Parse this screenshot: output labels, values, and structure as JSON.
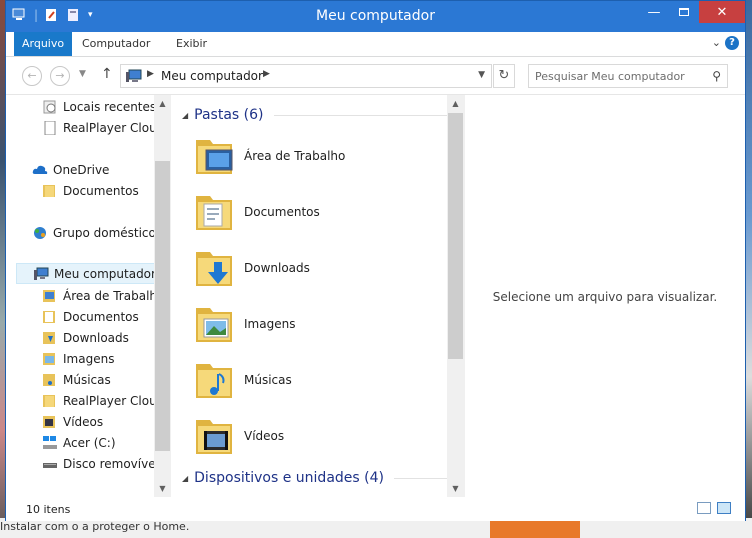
{
  "window": {
    "title": "Meu computador"
  },
  "ribbon": {
    "tabs": [
      "Arquivo",
      "Computador",
      "Exibir"
    ]
  },
  "address": {
    "crumb": "Meu computador"
  },
  "search": {
    "placeholder": "Pesquisar Meu computador"
  },
  "nav": {
    "items": [
      {
        "label": "Locais recentes",
        "icon": "recent-places-icon"
      },
      {
        "label": "RealPlayer Cloud",
        "icon": "document-icon"
      },
      {
        "label": "OneDrive",
        "icon": "cloud-icon"
      },
      {
        "label": "Documentos",
        "icon": "folder-icon"
      },
      {
        "label": "Grupo doméstico",
        "icon": "homegroup-icon"
      },
      {
        "label": "Meu computador",
        "icon": "computer-icon",
        "selected": true
      },
      {
        "label": "Área de Trabalho",
        "icon": "folder-icon"
      },
      {
        "label": "Documentos",
        "icon": "folder-icon"
      },
      {
        "label": "Downloads",
        "icon": "folder-icon"
      },
      {
        "label": "Imagens",
        "icon": "folder-icon"
      },
      {
        "label": "Músicas",
        "icon": "folder-icon"
      },
      {
        "label": "RealPlayer Cloud",
        "icon": "folder-icon"
      },
      {
        "label": "Vídeos",
        "icon": "folder-icon"
      },
      {
        "label": "Acer (C:)",
        "icon": "drive-icon"
      },
      {
        "label": "Disco removível (",
        "icon": "removable-drive-icon"
      }
    ]
  },
  "groups": {
    "folders_title": "Pastas (6)",
    "devices_title": "Dispositivos e unidades (4)"
  },
  "folders": [
    {
      "label": "Área de Trabalho",
      "icon": "desktop-folder-icon"
    },
    {
      "label": "Documentos",
      "icon": "documents-folder-icon"
    },
    {
      "label": "Downloads",
      "icon": "downloads-folder-icon"
    },
    {
      "label": "Imagens",
      "icon": "pictures-folder-icon"
    },
    {
      "label": "Músicas",
      "icon": "music-folder-icon"
    },
    {
      "label": "Vídeos",
      "icon": "videos-folder-icon"
    }
  ],
  "preview": {
    "message": "Selecione um arquivo para visualizar."
  },
  "status": {
    "count": "10 itens"
  },
  "background": {
    "taskbar_text": "Instalar com o a proteger o Home."
  },
  "colors": {
    "titlebar": "#2b78d4",
    "file_tab": "#1979ca",
    "close_button": "#c74040",
    "group_heading": "#1e3287"
  }
}
